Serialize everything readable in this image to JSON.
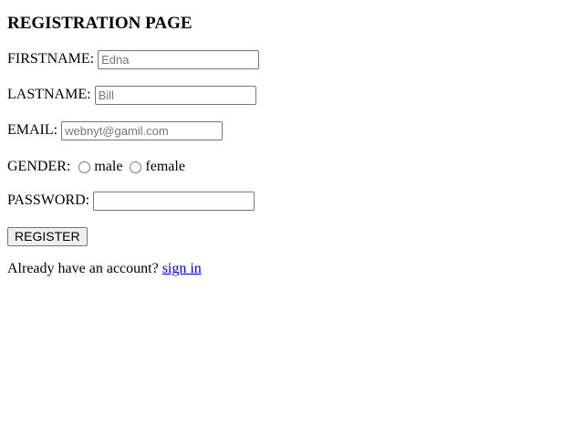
{
  "page": {
    "title": "REGISTRATION PAGE"
  },
  "form": {
    "firstname": {
      "label": "FIRSTNAME:",
      "placeholder": "Edna"
    },
    "lastname": {
      "label": "LASTNAME:",
      "placeholder": "Bill"
    },
    "email": {
      "label": "EMAIL:",
      "placeholder": "webnyt@gamil.com"
    },
    "gender": {
      "label": "GENDER:",
      "options": [
        {
          "label": "male",
          "checked": false
        },
        {
          "label": "female",
          "checked": false
        }
      ]
    },
    "password": {
      "label": "PASSWORD:",
      "placeholder": ""
    },
    "register_label": "REGISTER"
  },
  "footer": {
    "prompt": "Already have an account?",
    "signin_label": "sign in"
  }
}
